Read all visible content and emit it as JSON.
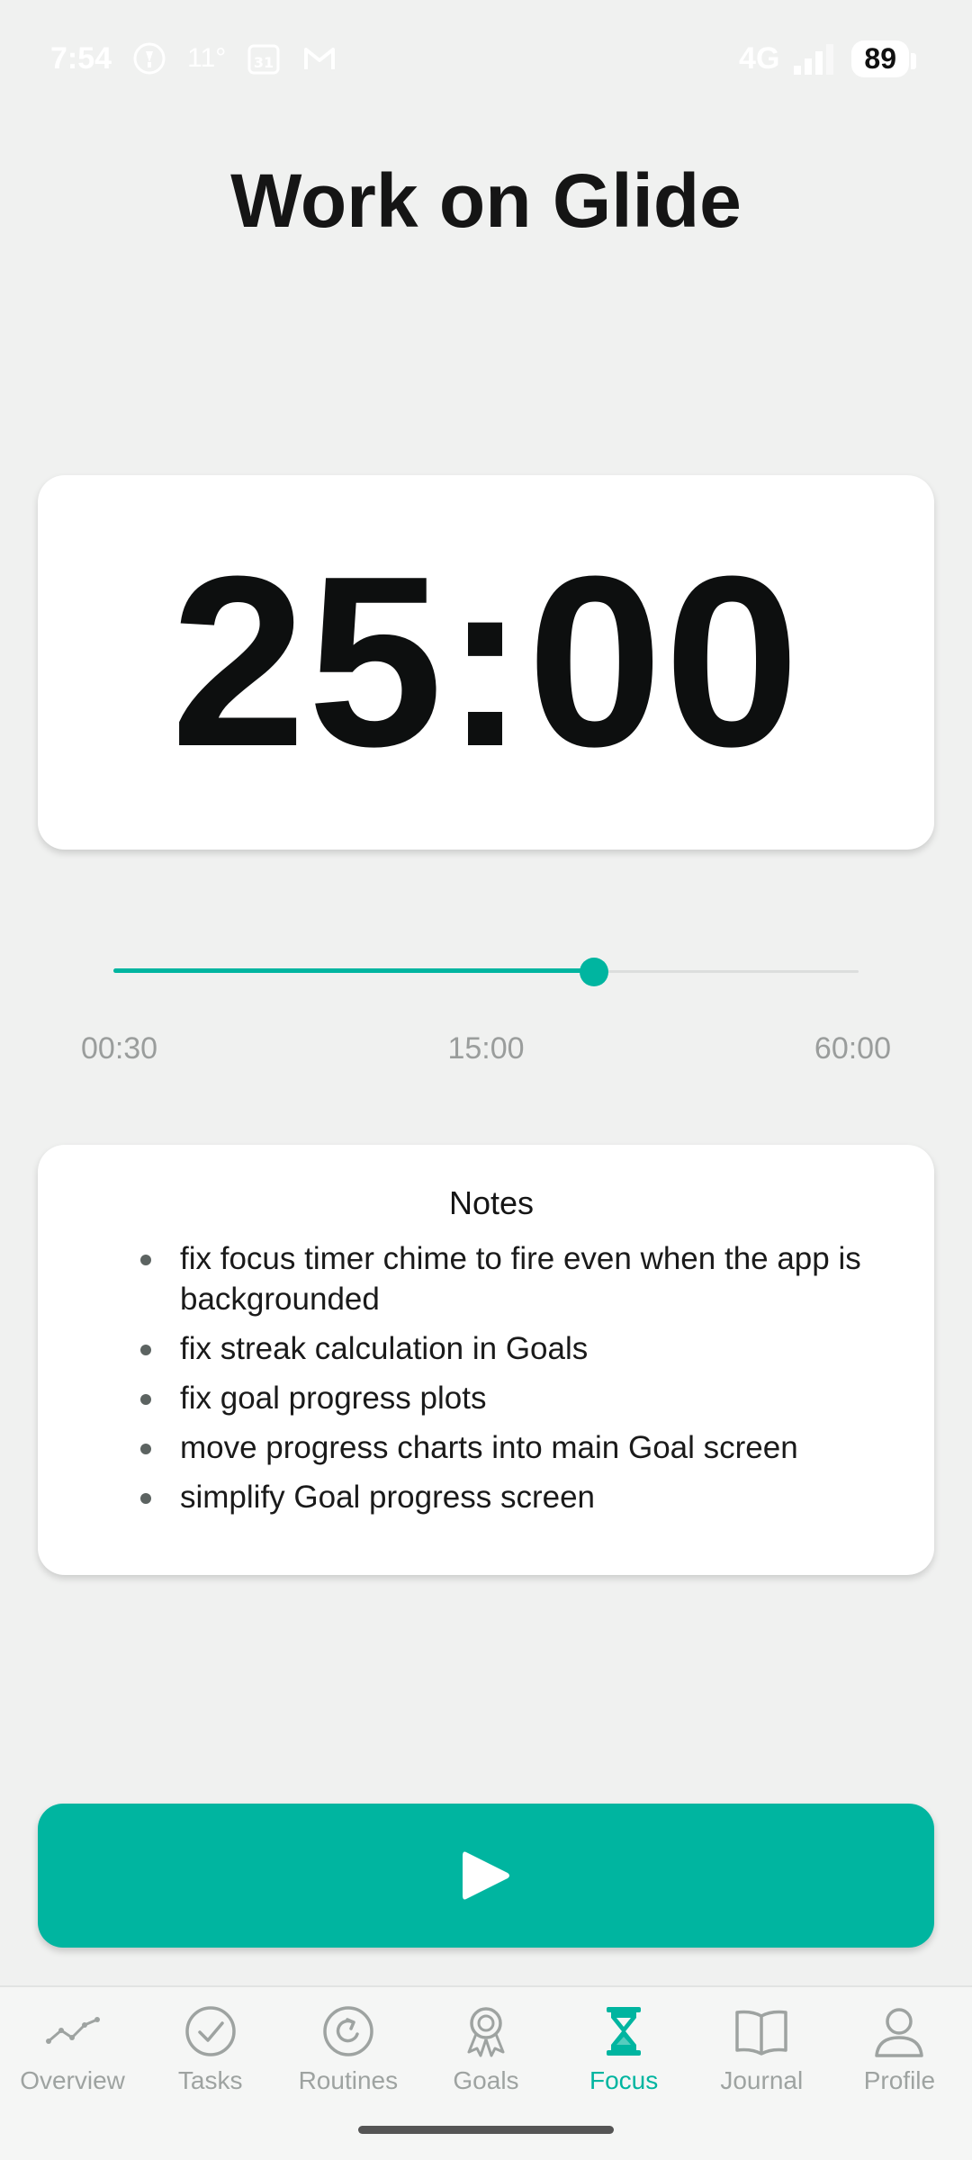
{
  "status_bar": {
    "time": "7:54",
    "temperature": "11°",
    "calendar": "31",
    "network": "4G",
    "battery": "89"
  },
  "title": "Work on Glide",
  "timer": {
    "display": "25:00"
  },
  "slider": {
    "min_label": "00:30",
    "mid_label": "15:00",
    "max_label": "60:00",
    "value_fraction": 0.645
  },
  "notes": {
    "title": "Notes",
    "items": [
      "fix focus timer chime to fire even when the app is backgrounded",
      "fix streak calculation in Goals",
      "fix goal progress plots",
      "move progress charts into main Goal screen",
      "simplify Goal progress screen"
    ]
  },
  "play_button": {
    "icon": "play-icon"
  },
  "nav": {
    "items": [
      {
        "label": "Overview",
        "icon": "chart-line-icon"
      },
      {
        "label": "Tasks",
        "icon": "check-circle-icon"
      },
      {
        "label": "Routines",
        "icon": "refresh-circle-icon"
      },
      {
        "label": "Goals",
        "icon": "medal-icon"
      },
      {
        "label": "Focus",
        "icon": "hourglass-icon"
      },
      {
        "label": "Journal",
        "icon": "book-icon"
      },
      {
        "label": "Profile",
        "icon": "person-icon"
      }
    ],
    "active": "Focus"
  },
  "colors": {
    "accent": "#00b5a0",
    "background": "#f0f1f0",
    "card": "#ffffff",
    "inactive": "#9ea3a1"
  }
}
